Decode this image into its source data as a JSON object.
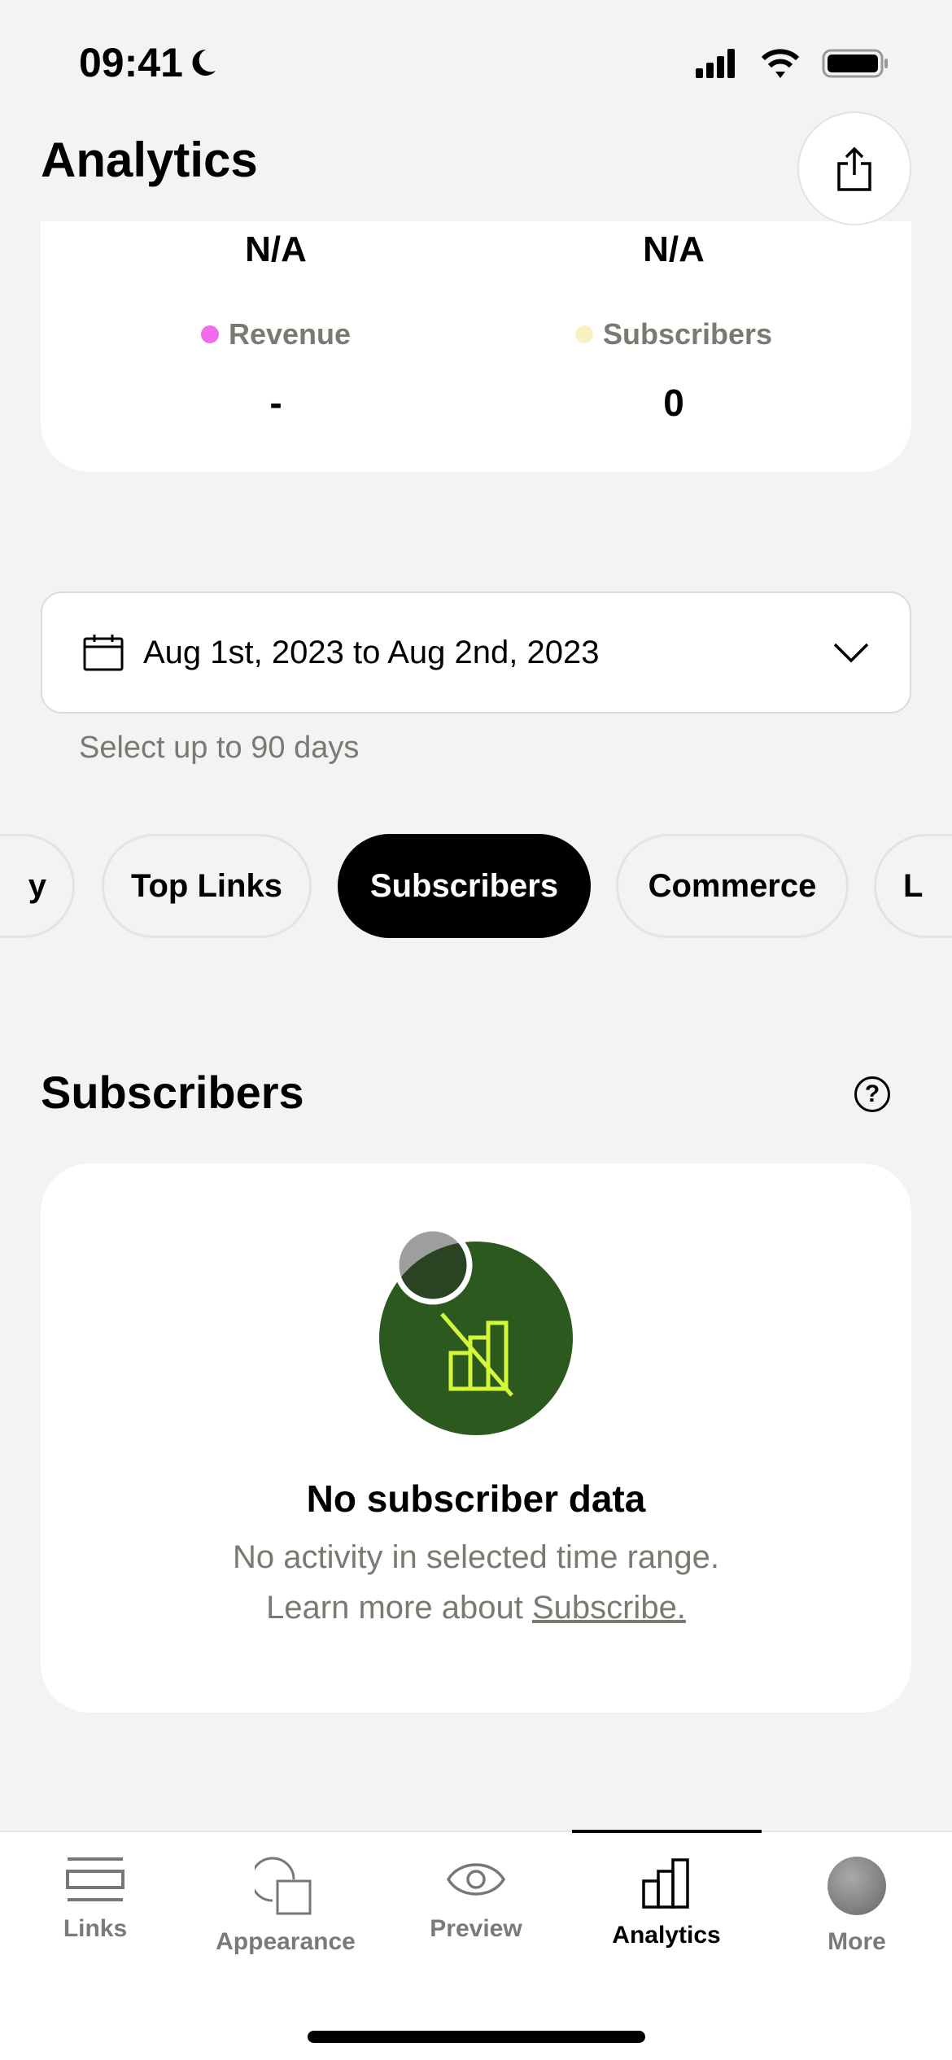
{
  "status": {
    "time": "09:41"
  },
  "header": {
    "title": "Analytics"
  },
  "summary": {
    "top_values": [
      "N/A",
      "N/A"
    ],
    "metrics": [
      {
        "label": "Revenue",
        "value": "-",
        "color": "#f06ce8"
      },
      {
        "label": "Subscribers",
        "value": "0",
        "color": "#fbf0c0"
      }
    ]
  },
  "date_range": {
    "value": "Aug 1st, 2023 to Aug 2nd, 2023",
    "hint": "Select up to 90 days"
  },
  "chips": [
    {
      "label": "y"
    },
    {
      "label": "Top Links"
    },
    {
      "label": "Subscribers",
      "active": true
    },
    {
      "label": "Commerce"
    },
    {
      "label": "L"
    }
  ],
  "section": {
    "title": "Subscribers",
    "empty_title": "No subscriber data",
    "empty_line1": "No activity in selected time range.",
    "empty_line2_prefix": "Learn more about ",
    "empty_link": "Subscribe."
  },
  "colors": {
    "accent_green": "#2c5a1e",
    "icon_lime": "#d4f73a"
  },
  "tabs": [
    {
      "label": "Links"
    },
    {
      "label": "Appearance"
    },
    {
      "label": "Preview"
    },
    {
      "label": "Analytics",
      "active": true
    },
    {
      "label": "More"
    }
  ]
}
